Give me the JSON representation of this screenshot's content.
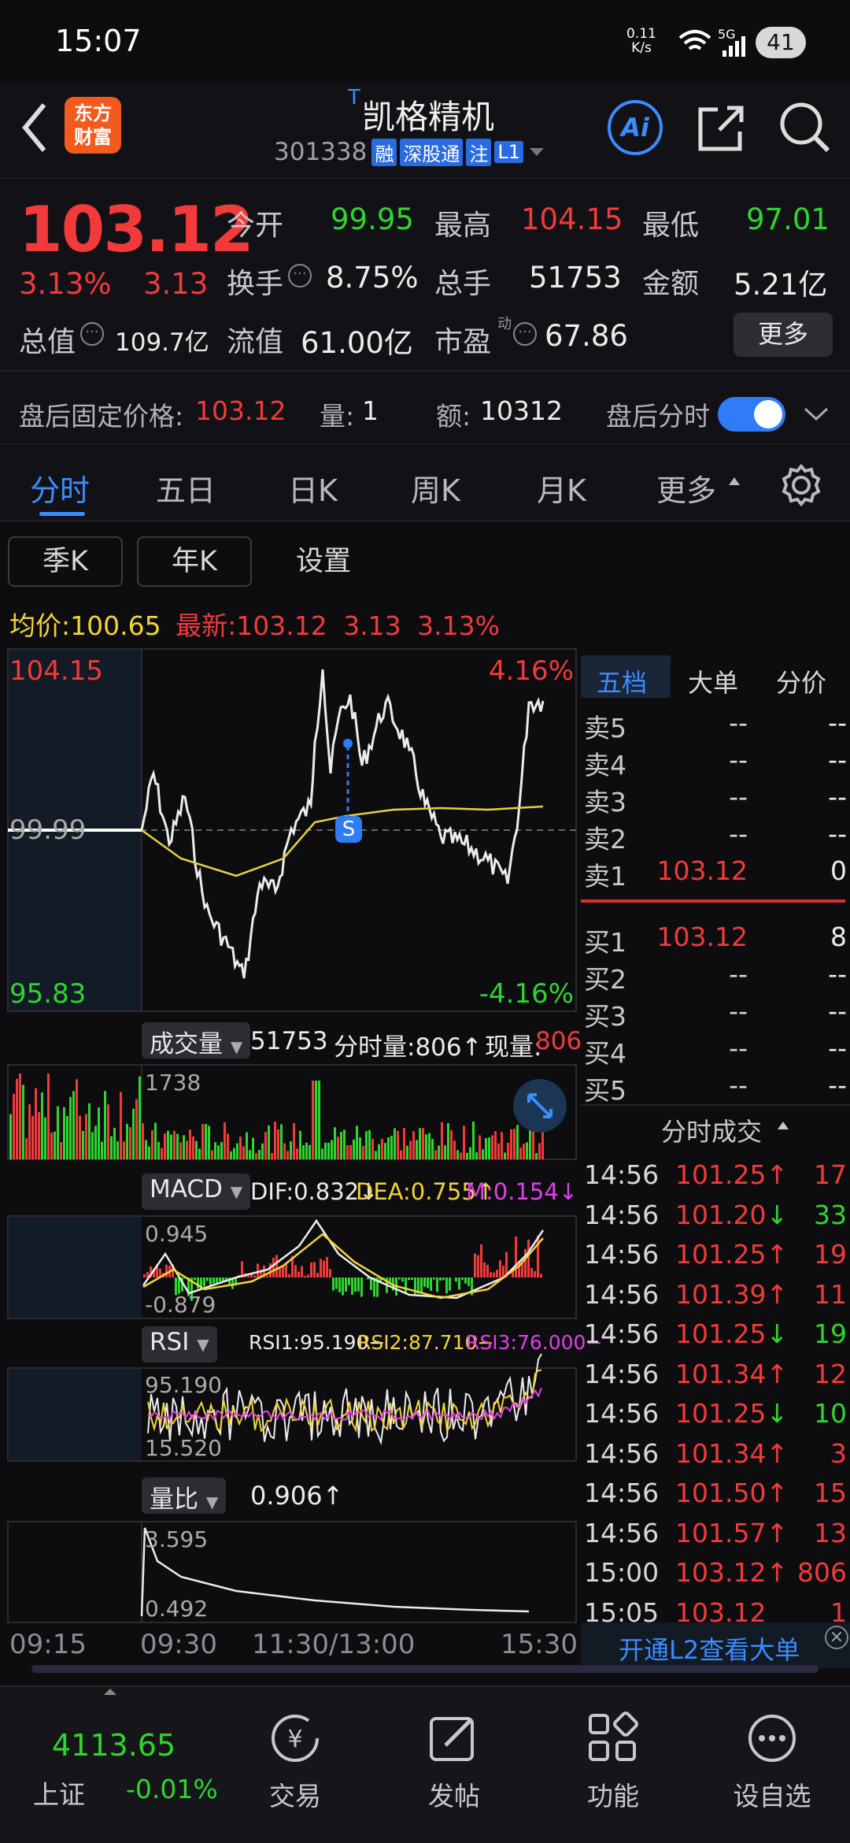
{
  "status": {
    "time": "15:07",
    "net_speed_top": "0.11",
    "net_speed_bottom": "K/s",
    "signal": "5G",
    "battery": "41"
  },
  "header": {
    "logo_line1": "东方",
    "logo_line2": "财富",
    "t_mark": "T",
    "stock_name": "凯格精机",
    "stock_code": "301338",
    "badges": [
      "融",
      "深股通",
      "注",
      "L1"
    ],
    "ai_label": "Ai"
  },
  "quote": {
    "price": "103.12",
    "pct": "3.13%",
    "change": "3.13",
    "open_label": "今开",
    "open": "99.95",
    "high_label": "最高",
    "high": "104.15",
    "low_label": "最低",
    "low": "97.01",
    "turnover_label": "换手",
    "turnover": "8.75%",
    "vol_label": "总手",
    "vol": "51753",
    "amount_label": "金额",
    "amount": "5.21亿",
    "mcap_label": "总值",
    "mcap": "109.7亿",
    "float_label": "流值",
    "float": "61.00亿",
    "pe_label": "市盈",
    "pe_sup": "动",
    "pe": "67.86",
    "more_button": "更多"
  },
  "afterhours": {
    "fixed_label": "盘后固定价格:",
    "fixed_price": "103.12",
    "qty_label": "量:",
    "qty": "1",
    "amt_label": "额:",
    "amt": "10312",
    "toggle_label": "盘后分时"
  },
  "tabs": [
    "分时",
    "五日",
    "日K",
    "周K",
    "月K",
    "更多"
  ],
  "subtabs": [
    "季K",
    "年K",
    "设置"
  ],
  "avg": {
    "avg_label": "均价:",
    "avg": "100.65",
    "latest_label": "最新:",
    "latest": "103.12",
    "chg": "3.13",
    "pct": "3.13%"
  },
  "chart": {
    "y_top": "104.15",
    "y_mid": "99.99",
    "y_bot": "95.83",
    "pct_top": "4.16%",
    "pct_bot": "-4.16%",
    "marker": "S",
    "vol_chip": "成交量",
    "vol_total": "51753",
    "vol_tick_label": "分时量:806↑",
    "vol_now_label": "现量:",
    "vol_now": "806",
    "vol_max": "1738",
    "macd_chip": "MACD",
    "dif": "DIF:0.832↓",
    "dea": "DEA:0.755↑",
    "m": "M:0.154↓",
    "macd_top": "0.945",
    "macd_bot": "-0.879",
    "rsi_chip": "RSI",
    "rsi1": "RSI1:95.190−",
    "rsi2": "RSI2:87.710−",
    "rsi3": "RSI3:76.000−",
    "rsi_top": "95.190",
    "rsi_bot": "15.520",
    "lb_chip": "量比",
    "lb_val": "0.906↑",
    "lb_top": "3.595",
    "lb_bot": "0.492",
    "x_labels": [
      "09:15",
      "09:30",
      "11:30/13:00",
      "15:30"
    ]
  },
  "orderbook": {
    "tabs": [
      "五档",
      "大单",
      "分价"
    ],
    "asks": [
      {
        "label": "卖5",
        "price": "--",
        "qty": "--"
      },
      {
        "label": "卖4",
        "price": "--",
        "qty": "--"
      },
      {
        "label": "卖3",
        "price": "--",
        "qty": "--"
      },
      {
        "label": "卖2",
        "price": "--",
        "qty": "--"
      },
      {
        "label": "卖1",
        "price": "103.12",
        "qty": "0"
      }
    ],
    "bids": [
      {
        "label": "买1",
        "price": "103.12",
        "qty": "8"
      },
      {
        "label": "买2",
        "price": "--",
        "qty": "--"
      },
      {
        "label": "买3",
        "price": "--",
        "qty": "--"
      },
      {
        "label": "买4",
        "price": "--",
        "qty": "--"
      },
      {
        "label": "买5",
        "price": "--",
        "qty": "--"
      }
    ],
    "ticks_title": "分时成交",
    "ticks": [
      {
        "t": "14:56",
        "p": "101.25↑",
        "q": "17",
        "dir": "up"
      },
      {
        "t": "14:56",
        "p": "101.20↓",
        "q": "33",
        "dir": "down"
      },
      {
        "t": "14:56",
        "p": "101.25↑",
        "q": "19",
        "dir": "up"
      },
      {
        "t": "14:56",
        "p": "101.39↑",
        "q": "11",
        "dir": "up"
      },
      {
        "t": "14:56",
        "p": "101.25↓",
        "q": "19",
        "dir": "down"
      },
      {
        "t": "14:56",
        "p": "101.34↑",
        "q": "12",
        "dir": "up"
      },
      {
        "t": "14:56",
        "p": "101.25↓",
        "q": "10",
        "dir": "down"
      },
      {
        "t": "14:56",
        "p": "101.34↑",
        "q": "3",
        "dir": "up"
      },
      {
        "t": "14:56",
        "p": "101.50↑",
        "q": "15",
        "dir": "up"
      },
      {
        "t": "14:56",
        "p": "101.57↑",
        "q": "13",
        "dir": "up"
      },
      {
        "t": "15:00",
        "p": "103.12↑",
        "q": "806",
        "dir": "up"
      },
      {
        "t": "15:05",
        "p": "103.12",
        "q": "1",
        "dir": "up"
      }
    ],
    "l2_promo": "开通L2查看大单"
  },
  "footer": {
    "index_value": "4113.65",
    "index_name": "上证",
    "index_pct": "-0.01%",
    "items": [
      "交易",
      "发帖",
      "功能",
      "设自选"
    ]
  },
  "colors": {
    "up": "#f23a3a",
    "down": "#2fd52f",
    "accent": "#2f7cf6",
    "avg_line": "#e8d040"
  }
}
